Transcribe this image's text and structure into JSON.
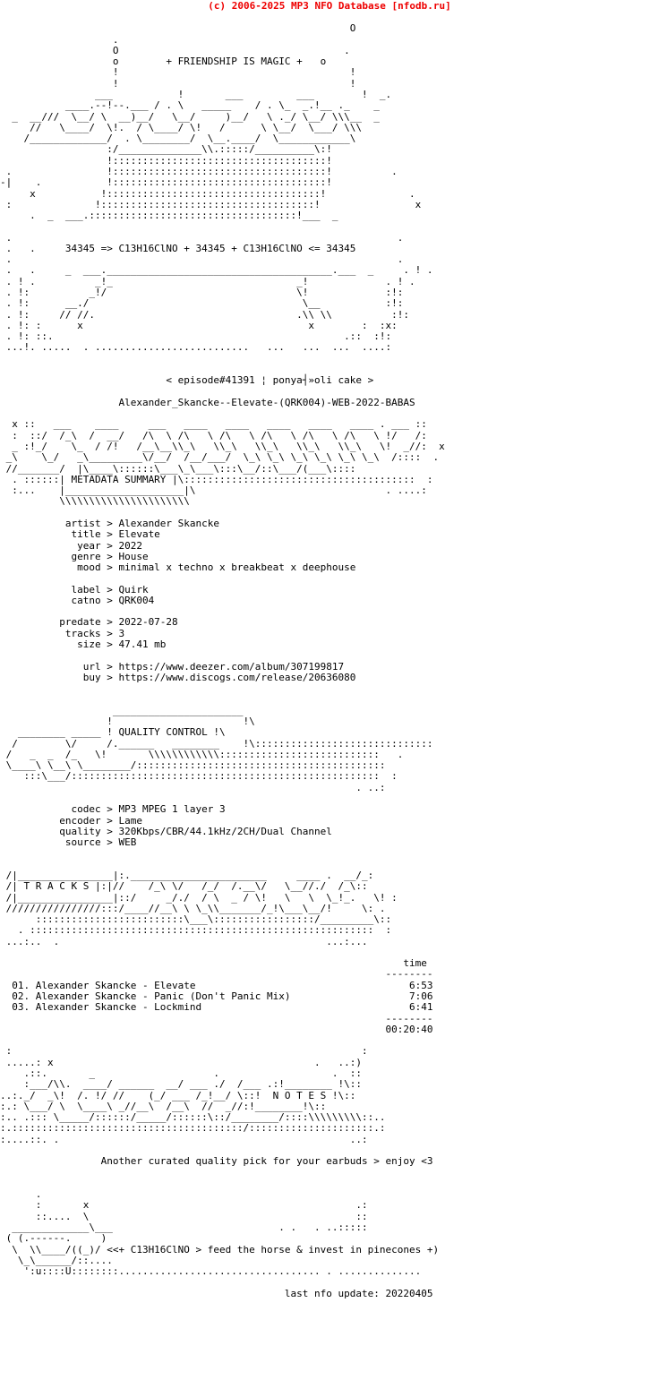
{
  "header": {
    "copyright": "(c) 2006-2025 MP3 NFO Database [nfodb.ru]",
    "color": "#ee0000"
  },
  "banner": {
    "tagline": "+ FRIENDSHIP IS MAGIC +",
    "formula_line": "34345 => C13H16ClNO + 34345 + C13H16ClNO <= 34345",
    "episode_line": "< episode#41391 ¦ ponya┤»oli cake >",
    "release_name": "Alexander_Skancke--Elevate-(QRK004)-WEB-2022-BABAS"
  },
  "sections": {
    "metadata_summary_label": "METADATA SUMMARY",
    "quality_control_label": "QUALITY CONTROL",
    "tracks_label": "T R A C K S",
    "notes_label": "N O T E S"
  },
  "metadata": {
    "separator": ">",
    "fields": [
      {
        "key": "artist",
        "value": "Alexander Skancke"
      },
      {
        "key": "title",
        "value": "Elevate"
      },
      {
        "key": "year",
        "value": "2022"
      },
      {
        "key": "genre",
        "value": "House"
      },
      {
        "key": "mood",
        "value": "minimal x techno x breakbeat x deephouse"
      }
    ],
    "label_fields": [
      {
        "key": "label",
        "value": "Quirk"
      },
      {
        "key": "catno",
        "value": "QRK004"
      }
    ],
    "release_fields": [
      {
        "key": "predate",
        "value": "2022-07-28"
      },
      {
        "key": "tracks",
        "value": "3"
      },
      {
        "key": "size",
        "value": "47.41 mb"
      }
    ],
    "link_fields": [
      {
        "key": "url",
        "value": "https://www.deezer.com/album/307199817"
      },
      {
        "key": "buy",
        "value": "https://www.discogs.com/release/20636080"
      }
    ]
  },
  "quality": {
    "fields": [
      {
        "key": "codec",
        "value": "MP3 MPEG 1 layer 3"
      },
      {
        "key": "encoder",
        "value": "Lame"
      },
      {
        "key": "quality",
        "value": "320Kbps/CBR/44.1kHz/2CH/Dual Channel"
      },
      {
        "key": "source",
        "value": "WEB"
      }
    ]
  },
  "tracklist": {
    "time_header": "time",
    "rule": "--------",
    "items": [
      {
        "num": "01.",
        "title": "Alexander Skancke - Elevate",
        "time": "6:53"
      },
      {
        "num": "02.",
        "title": "Alexander Skancke - Panic (Don't Panic Mix)",
        "time": "7:06"
      },
      {
        "num": "03.",
        "title": "Alexander Skancke - Lockmind",
        "time": "6:41"
      }
    ],
    "total": "00:20:40"
  },
  "notes": {
    "text": "Another curated quality pick for your earbuds > enjoy <3"
  },
  "footer": {
    "tagline": "<<+ C13H16ClNO > feed the horse & invest in pinecones +)",
    "last_update": "last nfo update: 20220405"
  },
  "ascii": {
    "top_logo": "                  .                                   O\n                  O                                   .\n                  o         + FRIENDSHIP IS MAGIC +   o\n                  !                                   !\n                  !                                   !\n                  !       ___                ___      !\n           ____.--!--.___ / . \\   _______    / . \\_  _.!__ ._\n   _  __///  \\__/ \\  __)__/   \\__/       )__/   \\ ._/ \\__/  \\\\\\__  _\n     //   \\____/  \\!   / \\____/  \\!     /       \\ \\__/  \\___/ \\\\\\\n    /_____________/ .  \\________/    \\__.______/  \\_____________\\\n                  !:/______________\\\\.:::::/__________\\:!\n                  !::::::::::::::::::::::::::::::::::::!\n .                !::::::::::::::::::::::::::::::::::::!            .\n .       _  ___.::::::::::::::::::::::::::::::::::::!___ _        x\n .                !::::::::::::::::::::::::::::::::::!\n",
    "mid_frame": " .   .     34345 => C13H16ClNO + 34345 + C13H16ClNO <= 34345\n .\n .   .     _  ___.____________________________________.___  _      . ! .\n . ! .          _!_                                 _!           . ! .\n . !:          _!/                                  \\!           :!:\n . !:      __./                                      \\__         :!:\n . !:     // //.                                    .\\\\ \\\\        :!:\n . !: :      x                                        x      :  :x:\n . !: ::.                                                  .:: :!:\n ...!. .....  . ...........................  ...  ...  ...   ....:\n"
  }
}
